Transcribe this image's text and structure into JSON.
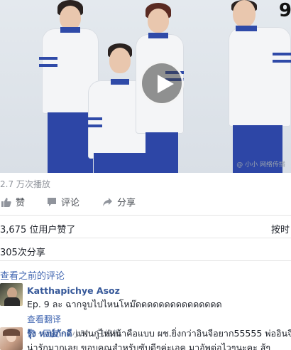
{
  "video": {
    "corner_label": "9",
    "watermark": "@ 小小 网络传播"
  },
  "stats": {
    "views": "2.7 万次播放",
    "likes": "3,675 位用户赞了",
    "sort": "按时",
    "shares": "305次分享"
  },
  "actions": {
    "like": "赞",
    "comment": "评论",
    "share": "分享"
  },
  "comments_section": {
    "view_earlier": "查看之前的评论"
  },
  "comments": [
    {
      "author": "Katthapichye Asoz",
      "text": "Ep. 9 ละ ฉากจูบไปไหนโหม๊ดดดดดดดดดดดดดดด",
      "translate": "查看翻译",
      "like": "赞",
      "reply": "回复",
      "time": "1小时",
      "edited": "已编辑"
    },
    {
      "author": "รุ้ง หงษ์ภักดี",
      "text": "แฟนกูไห่หน้าคือแบบ ผช.ยิ่งกว่าอินจีอยาก55555 พ่ออินจี",
      "text2": "น่ารักมากเลย ขอบคุณสำหรับซับดีๆค่ะเอค มาอัพต่อไวๆนะคะ สู้ๆ"
    }
  ],
  "colors": {
    "link": "#4267b2",
    "author": "#365899",
    "muted": "#90949c",
    "uniform_blue": "#2f4aa8"
  }
}
